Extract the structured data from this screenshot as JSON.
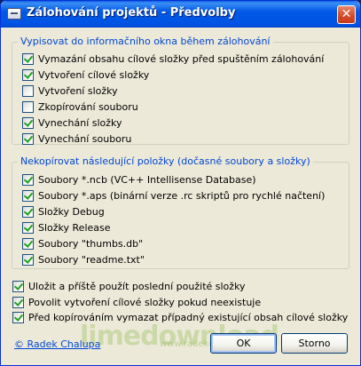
{
  "window": {
    "title": "Zálohování projektů - Předvolby"
  },
  "group1": {
    "legend": "Vypisovat do informačního okna během zálohování",
    "items": [
      {
        "label": "Vymazání obsahu cílové složky před spuštěním zálohování",
        "checked": true
      },
      {
        "label": "Vytvoření cílové složky",
        "checked": true
      },
      {
        "label": "Vytvoření složky",
        "checked": false
      },
      {
        "label": "Zkopírování souboru",
        "checked": false
      },
      {
        "label": "Vynechání složky",
        "checked": true
      },
      {
        "label": "Vynechání souboru",
        "checked": true
      }
    ]
  },
  "group2": {
    "legend": "Nekopírovat následující položky (dočasné soubory a složky)",
    "items": [
      {
        "label": "Soubory *.ncb (VC++ Intellisense Database)",
        "checked": true
      },
      {
        "label": "Soubory *.aps (binární verze .rc skriptů pro rychlé načtení)",
        "checked": true
      },
      {
        "label": "Složky Debug",
        "checked": true
      },
      {
        "label": "Složky Release",
        "checked": true
      },
      {
        "label": "Soubory \"thumbs.db\"",
        "checked": true
      },
      {
        "label": "Soubory \"readme.txt\"",
        "checked": true
      }
    ]
  },
  "options": [
    {
      "label": "Uložit a příště použít poslední použité složky",
      "checked": true
    },
    {
      "label": "Povolit vytvoření cílové složky pokud neexistuje",
      "checked": true
    },
    {
      "label": "Před kopírováním vymazat případný existující obsah cílové složky",
      "checked": true
    }
  ],
  "footer": {
    "link": "© Radek Chalupa",
    "ok_label": "OK",
    "cancel_label": "Storno"
  },
  "watermark": {
    "brand": "limedownload",
    "url": "www.radekchalupa.cz"
  },
  "colors": {
    "titlebar": "#0054e3",
    "legend": "#0046d5",
    "check": "#21a121",
    "face": "#ece9d8"
  }
}
